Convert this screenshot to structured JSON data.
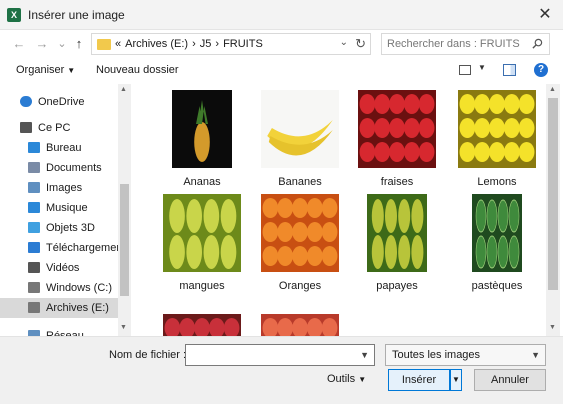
{
  "window": {
    "title": "Insérer une image",
    "app_icon_letter": "X",
    "close_glyph": "✕"
  },
  "nav": {
    "back": "←",
    "forward": "→",
    "recent": "⌄",
    "up": "↑",
    "breadcrumb": [
      "«",
      "Archives (E:)",
      "›",
      "J5",
      "›",
      "FRUITS"
    ],
    "search_placeholder": "Rechercher dans : FRUITS"
  },
  "toolbar": {
    "organize": "Organiser",
    "new_folder": "Nouveau dossier",
    "help": "?"
  },
  "sidebar": {
    "items": [
      {
        "label": "OneDrive",
        "icon": "cloud-icon",
        "color": "#2b7cd3"
      },
      {
        "label": "Ce PC",
        "icon": "computer-icon",
        "color": "#555555"
      },
      {
        "label": "Bureau",
        "icon": "desktop-icon",
        "color": "#2b88d8"
      },
      {
        "label": "Documents",
        "icon": "documents-icon",
        "color": "#7a8ba6"
      },
      {
        "label": "Images",
        "icon": "pictures-icon",
        "color": "#5f8fc0"
      },
      {
        "label": "Musique",
        "icon": "music-icon",
        "color": "#2b88d8"
      },
      {
        "label": "Objets 3D",
        "icon": "cube-icon",
        "color": "#3fa0e0"
      },
      {
        "label": "Téléchargement",
        "icon": "download-icon",
        "color": "#2b7cd3"
      },
      {
        "label": "Vidéos",
        "icon": "video-icon",
        "color": "#555555"
      },
      {
        "label": "Windows (C:)",
        "icon": "drive-icon",
        "color": "#777777"
      },
      {
        "label": "Archives (E:)",
        "icon": "drive-icon",
        "color": "#777777"
      },
      {
        "label": "Réseau",
        "icon": "network-icon",
        "color": "#5f8fc0"
      }
    ],
    "selected_index": 10
  },
  "files": [
    {
      "name": "Ananas",
      "kind": "pineapple",
      "bg": "#0b0b0b",
      "fruit": "#d39a2b"
    },
    {
      "name": "Bananes",
      "kind": "banana",
      "bg": "#f7f7f5",
      "fruit": "#f2d23a"
    },
    {
      "name": "fraises",
      "kind": "strawberry",
      "bg": "#6b1010",
      "fruit": "#d7282f"
    },
    {
      "name": "Lemons",
      "kind": "lemon",
      "bg": "#8a7a10",
      "fruit": "#f4e22a"
    },
    {
      "name": "mangues",
      "kind": "mango",
      "bg": "#6d8a1a",
      "fruit": "#c9d54a"
    },
    {
      "name": "Oranges",
      "kind": "orange",
      "bg": "#c84f12",
      "fruit": "#f08a2a"
    },
    {
      "name": "papayes",
      "kind": "papaya",
      "bg": "#3d6a18",
      "fruit": "#b8c43a"
    },
    {
      "name": "pastèques",
      "kind": "watermelon",
      "bg": "#1f4a1f",
      "fruit": "#3f8a3c"
    },
    {
      "name": "",
      "kind": "apple",
      "bg": "#6b1a1a",
      "fruit": "#c8303a"
    },
    {
      "name": "",
      "kind": "peach",
      "bg": "#b83a2a",
      "fruit": "#e86a4a"
    }
  ],
  "footer": {
    "filename_label": "Nom de fichier :",
    "filename_value": "",
    "filetype": "Toutes les images",
    "tools": "Outils",
    "open": "Insérer",
    "cancel": "Annuler"
  }
}
